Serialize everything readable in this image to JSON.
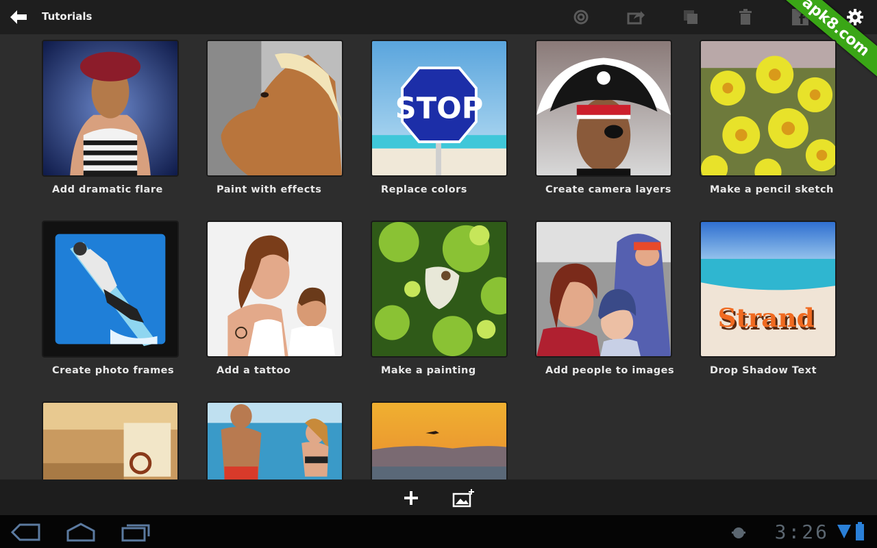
{
  "header": {
    "title": "Tutorials",
    "icons": [
      "back-arrow-icon",
      "creative-cloud-icon",
      "share-icon",
      "duplicate-icon",
      "trash-icon",
      "facebook-icon",
      "settings-gear-icon"
    ]
  },
  "watermark": "apk8.com",
  "tutorials": [
    {
      "label": "Add dramatic flare"
    },
    {
      "label": "Paint with effects"
    },
    {
      "label": "Replace colors"
    },
    {
      "label": "Create camera layers"
    },
    {
      "label": "Make a pencil sketch"
    },
    {
      "label": "Create photo frames"
    },
    {
      "label": "Add a tattoo"
    },
    {
      "label": "Make a painting"
    },
    {
      "label": "Add people to images"
    },
    {
      "label": "Drop Shadow Text"
    },
    {
      "label": ""
    },
    {
      "label": ""
    },
    {
      "label": ""
    }
  ],
  "thumb_text": {
    "stop": "STOP",
    "strand": "Strand"
  },
  "bottom_actions": [
    "add-icon",
    "add-image-icon"
  ],
  "system": {
    "clock": "3:26"
  },
  "colors": {
    "background": "#2d2d2d",
    "topbar": "#1e1e1e",
    "banner": "#3aa616"
  }
}
